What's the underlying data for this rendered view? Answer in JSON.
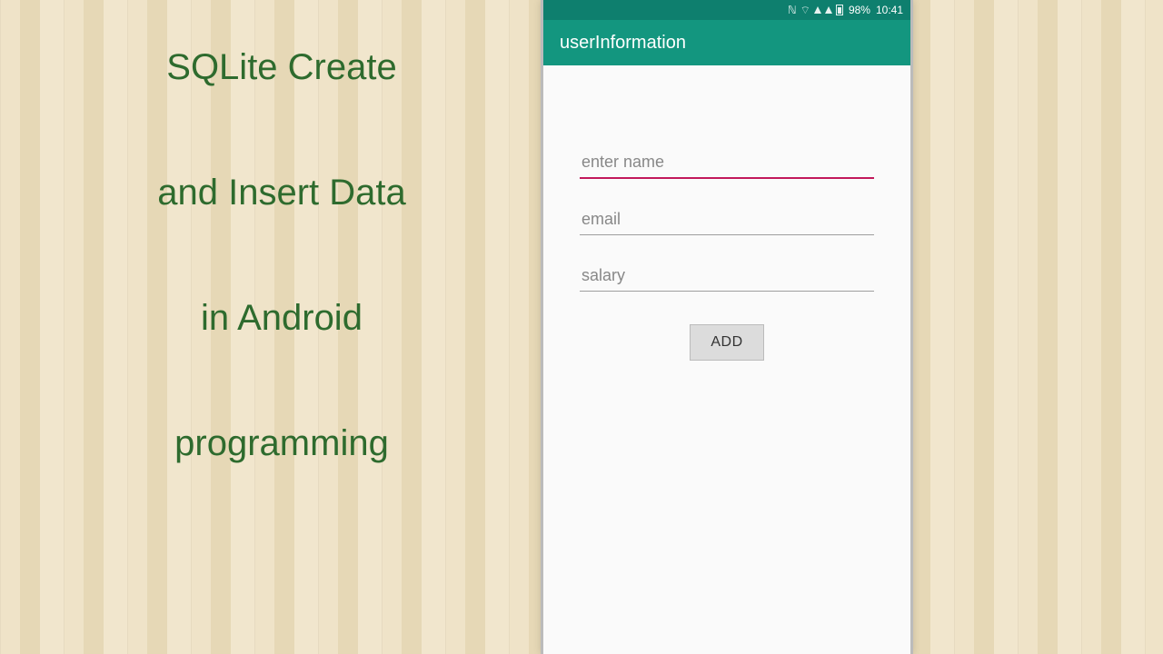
{
  "slide": {
    "line1": "SQLite Create",
    "line2": "and Insert Data",
    "line3": "in Android",
    "line4": "programming"
  },
  "status": {
    "battery_pct": "98%",
    "time": "10:41"
  },
  "app": {
    "title": "userInformation",
    "fields": {
      "name_placeholder": "enter name",
      "email_placeholder": "email",
      "salary_placeholder": "salary"
    },
    "add_label": "ADD"
  },
  "colors": {
    "title_text": "#2e6b2e",
    "appbar": "#13967f",
    "statusbar": "#0e7f6e",
    "accent": "#c2185b"
  }
}
